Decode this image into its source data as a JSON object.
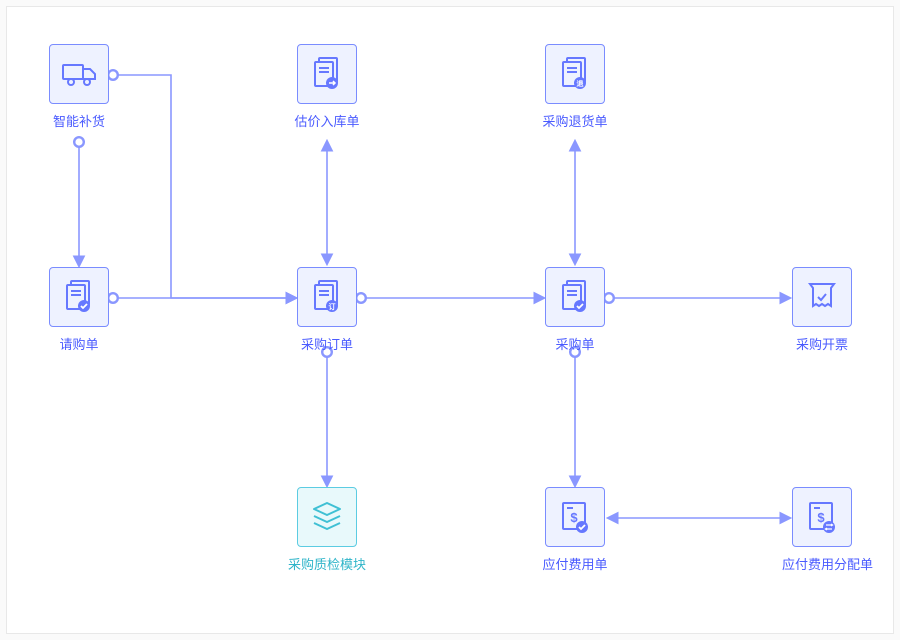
{
  "diagram": {
    "type": "process-flow",
    "nodes": {
      "smart_restock": {
        "label": "智能补货",
        "icon": "truck-icon"
      },
      "purchase_request": {
        "label": "请购单",
        "icon": "document-check-icon"
      },
      "valuation_inbound": {
        "label": "估价入库单",
        "icon": "document-arrow-icon"
      },
      "purchase_order": {
        "label": "采购订单",
        "icon": "document-order-icon"
      },
      "qc_module": {
        "label": "采购质检模块",
        "icon": "stack-icon"
      },
      "purchase_return": {
        "label": "采购退货单",
        "icon": "document-return-icon"
      },
      "purchase_receipt": {
        "label": "采购单",
        "icon": "document-check-icon"
      },
      "payable_expense": {
        "label": "应付费用单",
        "icon": "money-check-icon"
      },
      "purchase_invoice": {
        "label": "采购开票",
        "icon": "invoice-icon"
      },
      "payable_expense_alloc": {
        "label": "应付费用分配单",
        "icon": "money-swap-icon"
      }
    },
    "edges": [
      {
        "from": "smart_restock",
        "to": "purchase_request",
        "dir": "down"
      },
      {
        "from": "smart_restock",
        "to": "purchase_order",
        "dir": "down_right"
      },
      {
        "from": "purchase_request",
        "to": "purchase_order",
        "dir": "right"
      },
      {
        "from": "purchase_order",
        "to": "valuation_inbound",
        "dir": "both_vertical"
      },
      {
        "from": "purchase_order",
        "to": "qc_module",
        "dir": "down"
      },
      {
        "from": "purchase_order",
        "to": "purchase_receipt",
        "dir": "right"
      },
      {
        "from": "purchase_receipt",
        "to": "purchase_return",
        "dir": "both_vertical"
      },
      {
        "from": "purchase_receipt",
        "to": "payable_expense",
        "dir": "down"
      },
      {
        "from": "purchase_receipt",
        "to": "purchase_invoice",
        "dir": "right"
      },
      {
        "from": "payable_expense",
        "to": "payable_expense_alloc",
        "dir": "both_horizontal"
      }
    ],
    "colors": {
      "primary": "#6678ff",
      "primary_fill": "#eef2ff",
      "alt": "#3fc0d4",
      "alt_fill": "#e8f9fb",
      "arrow": "#8a97ff",
      "text_primary": "#4a5bff",
      "text_alt": "#2fb5c9"
    }
  }
}
